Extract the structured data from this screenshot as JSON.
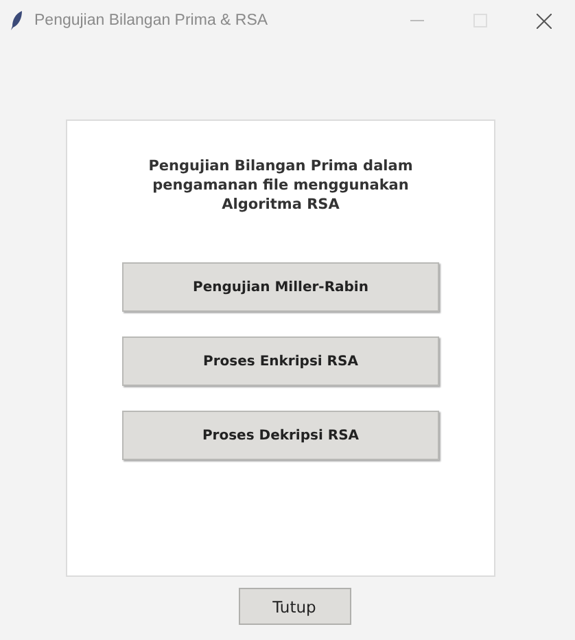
{
  "window": {
    "title": "Pengujian Bilangan Prima & RSA"
  },
  "heading": "Pengujian Bilangan Prima dalam pengamanan file menggunakan Algoritma RSA",
  "buttons": [
    "Pengujian Miller-Rabin",
    "Proses Enkripsi RSA",
    "Proses Dekripsi RSA"
  ],
  "close_button": "Tutup"
}
